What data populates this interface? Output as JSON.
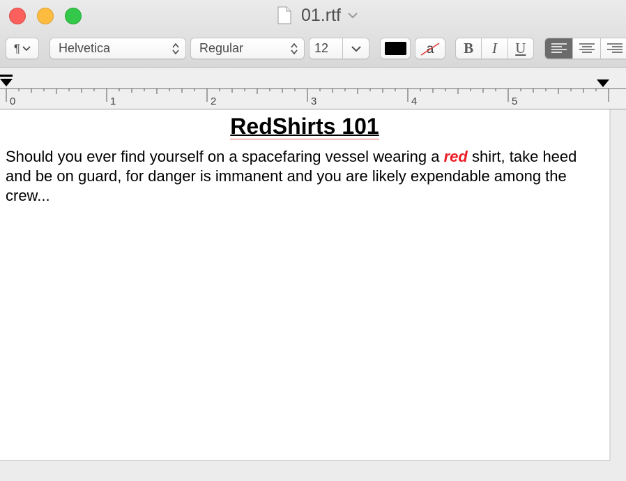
{
  "window": {
    "title": "01.rtf"
  },
  "toolbar": {
    "paragraph_icon": "pilcrow-icon",
    "font_family": "Helvetica",
    "font_style": "Regular",
    "font_size": "12",
    "text_color": "#000000",
    "bold_label": "B",
    "italic_label": "I",
    "underline_label": "U",
    "alignment_selected": "left"
  },
  "ruler": {
    "labels": [
      "0",
      "1",
      "2",
      "3",
      "4",
      "5"
    ]
  },
  "document": {
    "heading": "RedShirts 101",
    "paragraph_before": "Should you ever find yourself on a spacefaring vessel wearing a ",
    "emphasis_word": "red",
    "paragraph_after": " shirt, take heed and be on guard, for danger is immanent and you are likely expendable among the crew...",
    "emphasis_color": "#ec1c24"
  }
}
